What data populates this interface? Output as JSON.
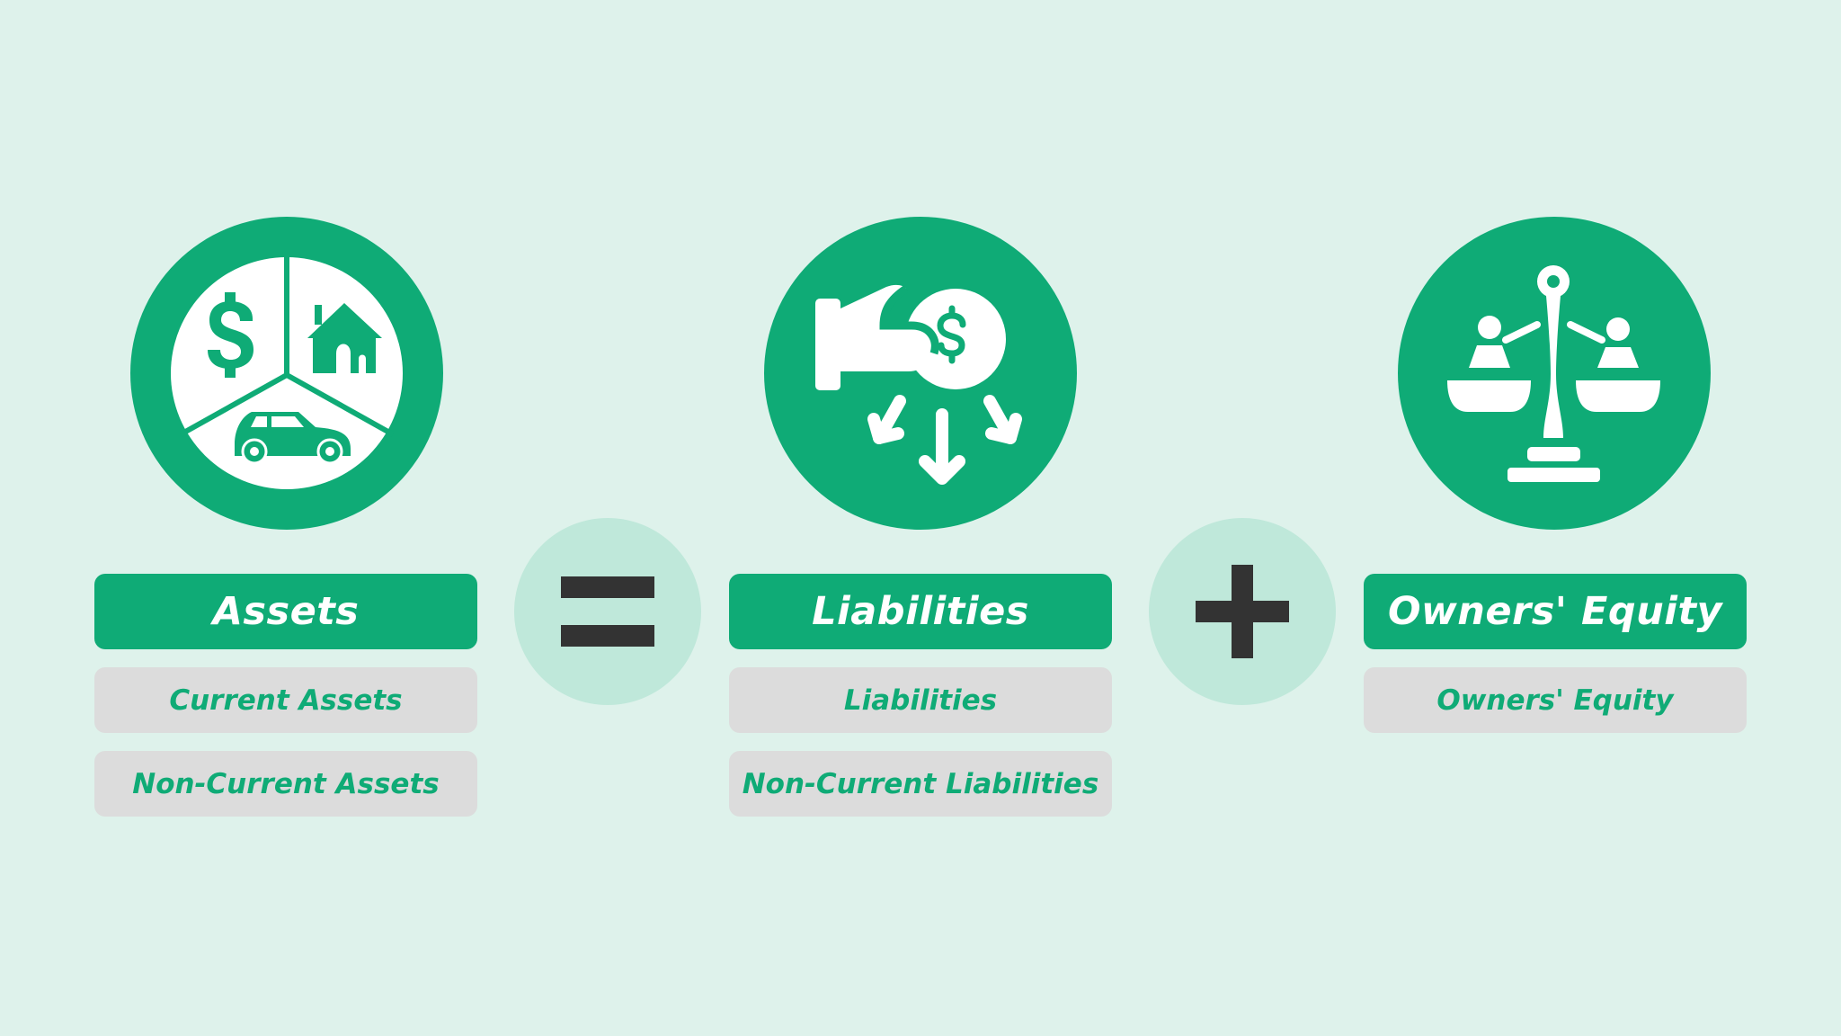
{
  "colors": {
    "background": "#DEF2EB",
    "brand_green": "#0FAB76",
    "operator_circle": "#BFE8DA",
    "sub_box": "#DCDCDC",
    "operator_symbol": "#333333",
    "icon_white": "#FFFFFF"
  },
  "equation": {
    "columns": [
      {
        "title": "Assets",
        "icon": "assets-pie-icon",
        "icon_parts": [
          "dollar-icon",
          "house-icon",
          "car-icon"
        ],
        "items": [
          "Current Assets",
          "Non-Current Assets"
        ]
      },
      {
        "title": "Liabilities",
        "icon": "hand-coin-outflow-icon",
        "icon_parts": [
          "hand-icon",
          "coin-dollar-icon",
          "arrows-down-icon"
        ],
        "items": [
          "Liabilities",
          "Non-Current Liabilities"
        ]
      },
      {
        "title": "Owners' Equity",
        "icon": "balance-scale-people-icon",
        "icon_parts": [
          "scale-icon",
          "person-icon",
          "person-icon"
        ],
        "items": [
          "Owners' Equity"
        ]
      }
    ],
    "operators": [
      {
        "symbol": "=",
        "name": "equals-icon"
      },
      {
        "symbol": "+",
        "name": "plus-icon"
      }
    ]
  }
}
